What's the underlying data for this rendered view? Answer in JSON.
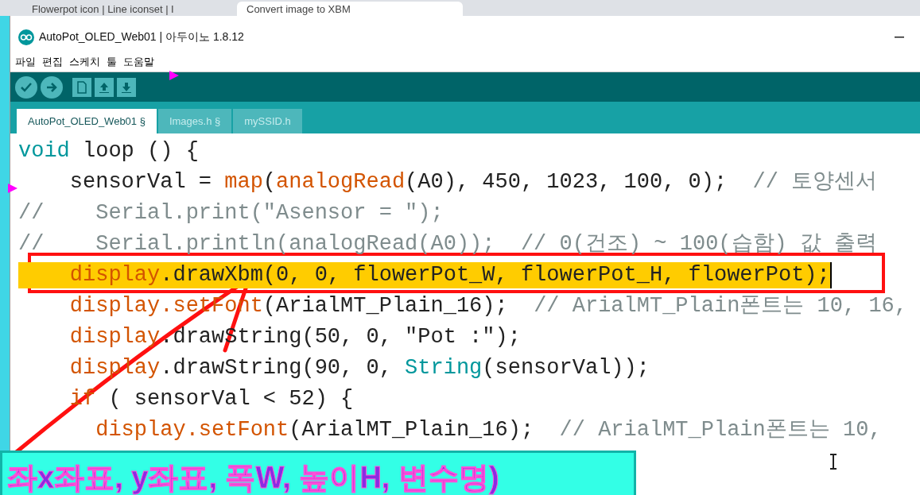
{
  "browser_tabs": [
    {
      "title": "Flowerpot icon | Line iconset | I",
      "selected": false
    },
    {
      "title": "Convert image to XBM",
      "selected": true
    }
  ],
  "window": {
    "title": "AutoPot_OLED_Web01 | 아두이노 1.8.12"
  },
  "menu": [
    "파일",
    "편집",
    "스케치",
    "툴",
    "도움말"
  ],
  "editor_tabs": [
    {
      "label": "AutoPot_OLED_Web01 §",
      "selected": true
    },
    {
      "label": "Images.h §",
      "selected": false
    },
    {
      "label": "mySSID.h",
      "selected": false
    }
  ],
  "code_lines": [
    {
      "highlighted": false,
      "tokens": [
        {
          "text": "void",
          "kind": "keyword"
        },
        {
          "text": " loop () {",
          "kind": "plain"
        }
      ]
    },
    {
      "highlighted": false,
      "tokens": [
        {
          "text": "    sensorVal = ",
          "kind": "plain"
        },
        {
          "text": "map",
          "kind": "function"
        },
        {
          "text": "(",
          "kind": "plain"
        },
        {
          "text": "analogRead",
          "kind": "function"
        },
        {
          "text": "(A0), 450, 1023, 100, 0);  ",
          "kind": "plain"
        },
        {
          "text": "// 토양센서",
          "kind": "comment"
        }
      ]
    },
    {
      "highlighted": false,
      "tokens": [
        {
          "text": "//    Serial.print(\"Asensor = \");",
          "kind": "comment"
        }
      ]
    },
    {
      "highlighted": false,
      "tokens": [
        {
          "text": "//    Serial.println(analogRead(A0));  // 0(건조) ~ 100(습함) 값 출력",
          "kind": "comment"
        }
      ]
    },
    {
      "highlighted": true,
      "tokens": [
        {
          "text": "    display",
          "kind": "function"
        },
        {
          "text": ".drawXbm(0, 0, flowerPot_W, flowerPot_H, flowerPot);",
          "kind": "plain"
        }
      ]
    },
    {
      "highlighted": false,
      "tokens": [
        {
          "text": "    display.setFont",
          "kind": "function"
        },
        {
          "text": "(ArialMT_Plain_16);  ",
          "kind": "plain"
        },
        {
          "text": "// ArialMT_Plain폰트는 10, 16,",
          "kind": "comment"
        }
      ]
    },
    {
      "highlighted": false,
      "tokens": [
        {
          "text": "    display",
          "kind": "function"
        },
        {
          "text": ".drawString(50, 0, \"Pot :\");",
          "kind": "plain"
        }
      ]
    },
    {
      "highlighted": false,
      "tokens": [
        {
          "text": "    display",
          "kind": "function"
        },
        {
          "text": ".drawString(90, 0, ",
          "kind": "plain"
        },
        {
          "text": "String",
          "kind": "keyword"
        },
        {
          "text": "(sensorVal));",
          "kind": "plain"
        }
      ]
    },
    {
      "highlighted": false,
      "tokens": [
        {
          "text": "    if",
          "kind": "function"
        },
        {
          "text": " ( sensorVal < 52) {",
          "kind": "plain"
        }
      ]
    },
    {
      "highlighted": false,
      "tokens": [
        {
          "text": "      display.setFont",
          "kind": "function"
        },
        {
          "text": "(ArialMT_Plain_16);  ",
          "kind": "plain"
        },
        {
          "text": "// ArialMT_Plain폰트는 10,",
          "kind": "comment"
        }
      ]
    }
  ],
  "caption": "좌x좌표, y좌표, 폭W, 높이H, 변수명)"
}
